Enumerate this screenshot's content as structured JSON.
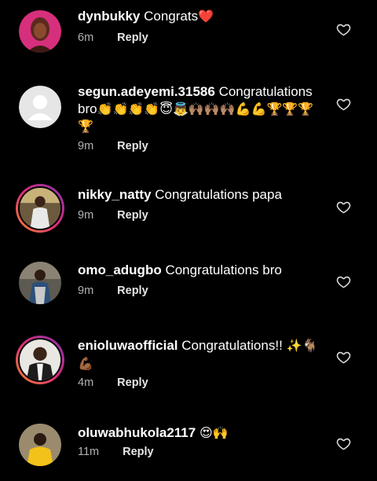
{
  "comments": [
    {
      "username": "dynbukky",
      "text": "Congrats",
      "emoji": "❤️",
      "time": "6m",
      "reply_label": "Reply",
      "avatar": "woman-portrait-avatar"
    },
    {
      "username": "segun.adeyemi.31586",
      "text": "Congratulations bro",
      "emoji": "👏👏👏👏😇👼🙌🏽🙌🏽🙌🏽💪💪🏆🏆🏆🏆",
      "time": "9m",
      "reply_label": "Reply",
      "avatar": "default-user-avatar"
    },
    {
      "username": "nikky_natty",
      "text": "Congratulations papa",
      "emoji": "",
      "time": "9m",
      "reply_label": "Reply",
      "avatar": "man-portrait-avatar"
    },
    {
      "username": "omo_adugbo",
      "text": "Congratulations bro",
      "emoji": "",
      "time": "9m",
      "reply_label": "Reply",
      "avatar": "man-portrait-avatar"
    },
    {
      "username": "enioluwaofficial",
      "text": "Congratulations!!",
      "emoji": "✨🐐💪🏾",
      "time": "4m",
      "reply_label": "Reply",
      "avatar": "man-suit-avatar"
    },
    {
      "username": "oluwabhukola2117",
      "text": "",
      "emoji": "😍🙌",
      "time": "11m",
      "reply_label": "Reply",
      "avatar": "woman-yellow-avatar"
    }
  ],
  "colors": {
    "background": "#000000",
    "text": "#ffffff",
    "meta": "#b3b3b3",
    "heart_emoji": "#e0245e"
  }
}
